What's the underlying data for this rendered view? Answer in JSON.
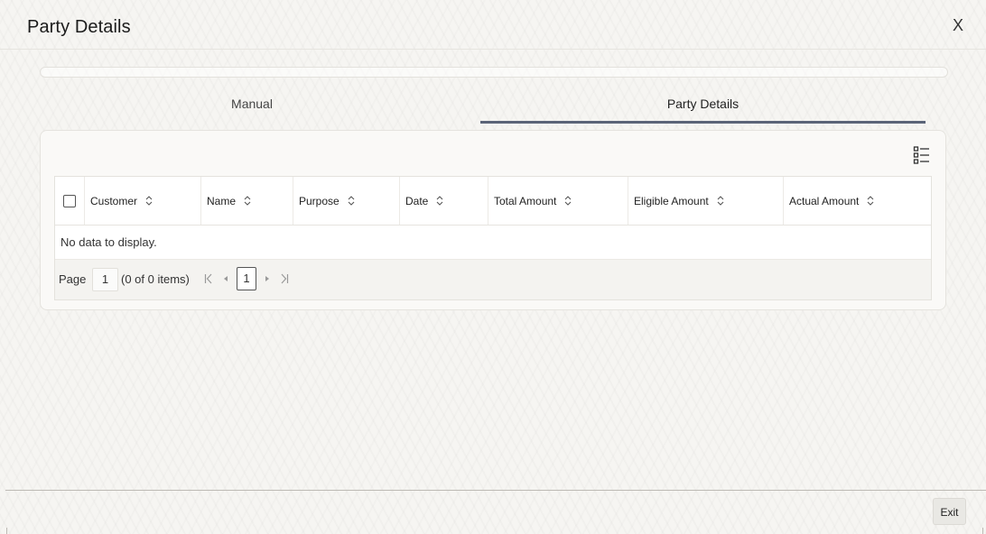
{
  "dialog": {
    "title": "Party Details",
    "close_label": "X"
  },
  "tabs": [
    {
      "label": "Manual",
      "active": false
    },
    {
      "label": "Party Details",
      "active": true
    }
  ],
  "grid": {
    "columns": [
      {
        "label": "Customer"
      },
      {
        "label": "Name"
      },
      {
        "label": "Purpose"
      },
      {
        "label": "Date"
      },
      {
        "label": "Total Amount"
      },
      {
        "label": "Eligible Amount"
      },
      {
        "label": "Actual Amount"
      }
    ],
    "empty_message": "No data to display.",
    "rows": []
  },
  "pager": {
    "label": "Page",
    "current_page": "1",
    "count_text": "(0 of 0 items)",
    "first_icon": "first-page-icon",
    "prev_icon": "previous-page-icon",
    "next_icon": "next-page-icon",
    "last_icon": "last-page-icon",
    "page_button": "1"
  },
  "footer": {
    "exit_label": "Exit"
  },
  "colors": {
    "active_tab_underline": "#5b6478",
    "background": "#f6f5f2"
  }
}
